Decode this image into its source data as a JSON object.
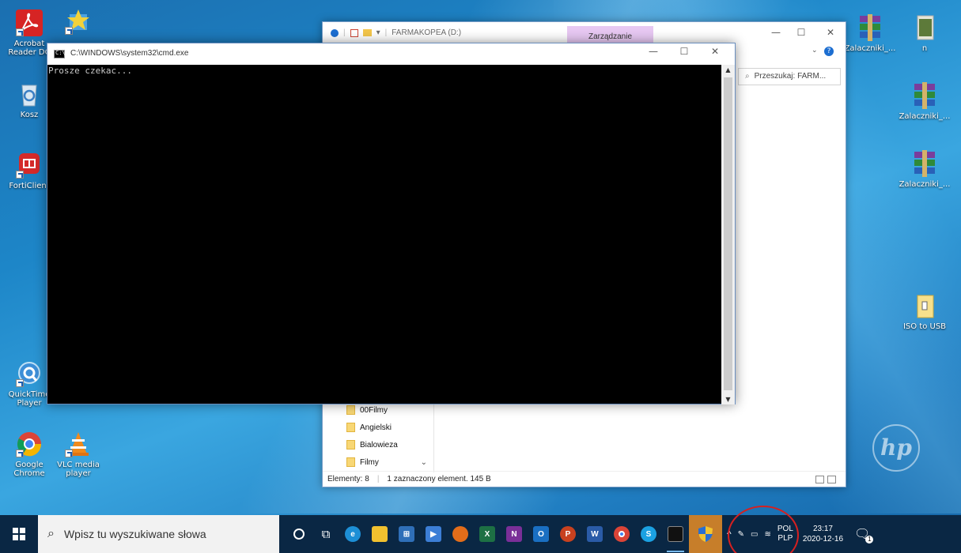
{
  "desktop": {
    "icons_left": [
      {
        "label": "Acrobat Reader DC",
        "icon": "acrobat-icon"
      },
      {
        "label": "",
        "icon": "setup-shortcut-icon"
      },
      {
        "label": "Kosz",
        "icon": "recycle-bin-icon"
      },
      {
        "label": "FortiClient",
        "icon": "forticlient-icon"
      },
      {
        "label": "QuickTime Player",
        "icon": "quicktime-icon"
      },
      {
        "label": "Google Chrome",
        "icon": "chrome-icon"
      },
      {
        "label": "VLC media player",
        "icon": "vlc-icon"
      }
    ],
    "icons_right": [
      {
        "label": "Zalaczniki_...",
        "icon": "winrar-icon"
      },
      {
        "label": "n",
        "icon": "image-icon"
      },
      {
        "label": "Zalaczniki_...",
        "icon": "winrar-icon"
      },
      {
        "label": "Zalaczniki_...",
        "icon": "winrar-icon"
      },
      {
        "label": "ISO to USB",
        "icon": "folder-icon"
      }
    ],
    "brand_logo": "hp"
  },
  "explorer": {
    "title": "FARMAKOPEA (D:)",
    "context_tab": "Zarządzanie",
    "search_placeholder": "Przeszukaj: FARM...",
    "nav_items": [
      "00Filmy",
      "Angielski",
      "Bialowieza",
      "Filmy"
    ],
    "status_items": "Elementy: 8",
    "status_selected": "1 zaznaczony element. 145 B",
    "minimize": "—",
    "maximize": "☐",
    "close": "✕"
  },
  "cmd": {
    "title": "C:\\WINDOWS\\system32\\cmd.exe",
    "output": "Prosze czekac...",
    "minimize": "—",
    "maximize": "☐",
    "close": "✕"
  },
  "taskbar": {
    "search_placeholder": "Wpisz tu wyszukiwane słowa",
    "apps": [
      {
        "name": "cortana",
        "label": "O",
        "color": "transparent"
      },
      {
        "name": "task-view",
        "label": "⊞",
        "color": "transparent"
      },
      {
        "name": "edge",
        "label": "e",
        "color": "#1d8fd6"
      },
      {
        "name": "file-explorer",
        "label": "▬",
        "color": "#f1c12f"
      },
      {
        "name": "store",
        "label": "▣",
        "color": "#2f6fb8"
      },
      {
        "name": "media",
        "label": "▶",
        "color": "#3c7ed6"
      },
      {
        "name": "firefox",
        "label": "●",
        "color": "#e36d1a"
      },
      {
        "name": "excel",
        "label": "X",
        "color": "#1d7044"
      },
      {
        "name": "onenote",
        "label": "N",
        "color": "#7a2f98"
      },
      {
        "name": "outlook",
        "label": "O",
        "color": "#1a6fc2"
      },
      {
        "name": "powerpoint",
        "label": "P",
        "color": "#c8411f"
      },
      {
        "name": "word",
        "label": "W",
        "color": "#2a5ba7"
      },
      {
        "name": "chrome",
        "label": "●",
        "color": "#3b8e3f"
      },
      {
        "name": "skype",
        "label": "S",
        "color": "#1ba1e2"
      },
      {
        "name": "cmd",
        "label": "C:\\",
        "color": "#111"
      }
    ],
    "tray": {
      "lang_top": "POL",
      "lang_bottom": "PLP",
      "time": "23:17",
      "date": "2020-12-16",
      "notification_count": "1"
    }
  }
}
